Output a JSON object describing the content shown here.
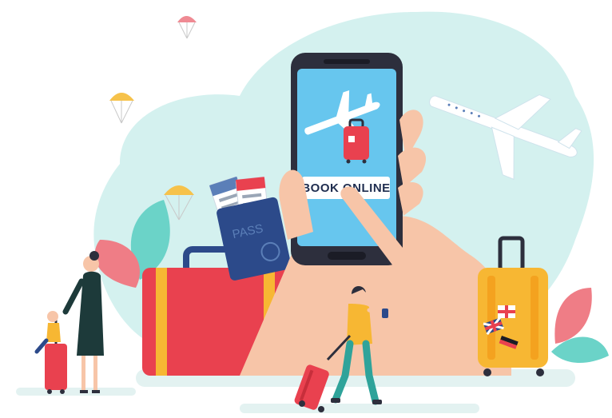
{
  "phone": {
    "button_label": "BOOK ONLINE"
  },
  "passport": {
    "label": "PASS"
  },
  "colors": {
    "background_blob": "#d4f1ef",
    "phone_body": "#2d2f3d",
    "phone_screen": "#67c6ee",
    "suitcase_red": "#e9414f",
    "suitcase_yellow": "#f7b733",
    "passport_blue": "#2c4a8a",
    "leaf_pink": "#ef7d86",
    "leaf_teal": "#6bd3c8",
    "skin": "#f7c5a8",
    "parachute_pink": "#ef8a93",
    "parachute_yellow": "#f6c24a"
  },
  "icons": [
    "airplane-large",
    "airplane-on-screen",
    "parachute-pink",
    "parachute-yellow-top",
    "parachute-yellow-mid",
    "flag-england-sticker",
    "flag-uk-sticker",
    "flag-germany-sticker"
  ]
}
